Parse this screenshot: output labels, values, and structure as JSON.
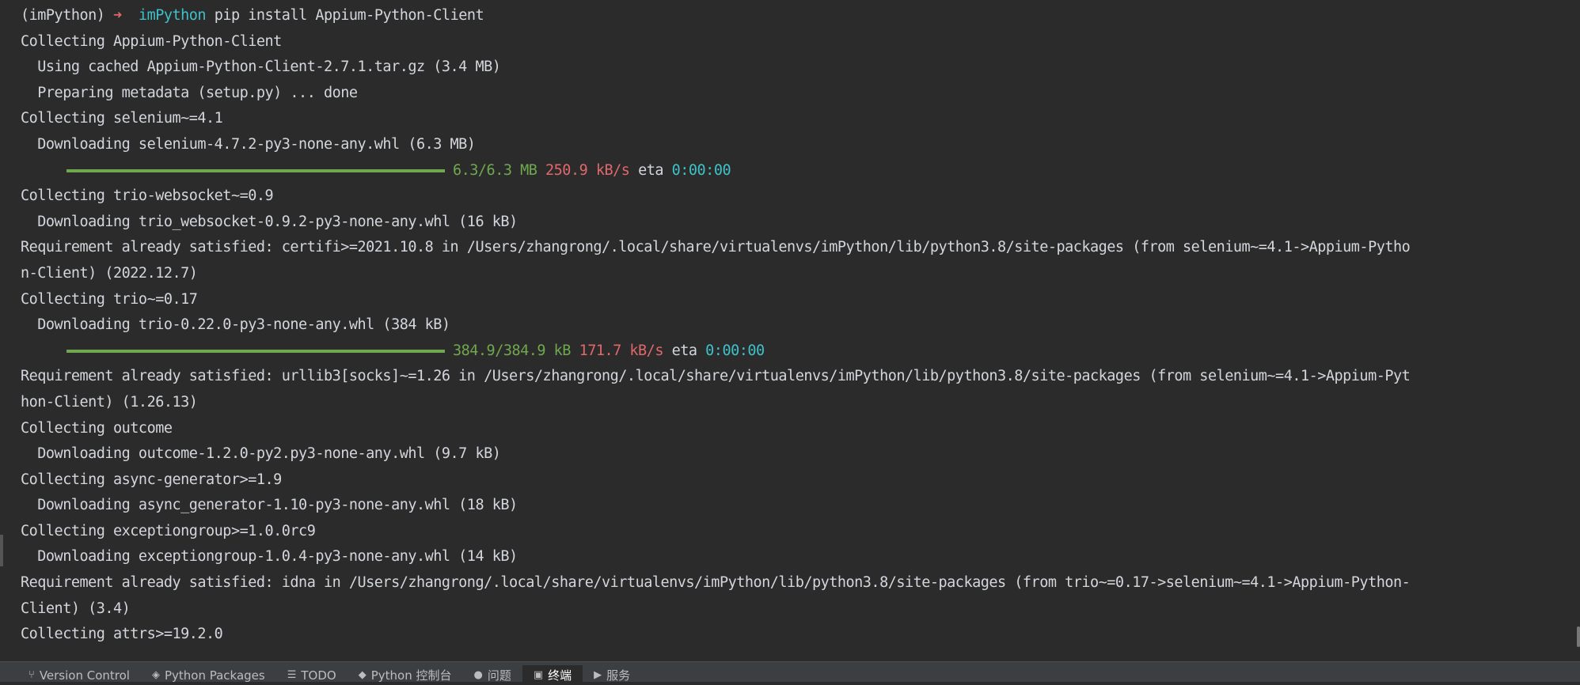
{
  "prompt": {
    "env": "(imPython)",
    "arrow": "➜",
    "dir": "imPython",
    "command": "pip install Appium-Python-Client"
  },
  "lines": [
    "Collecting Appium-Python-Client",
    "  Using cached Appium-Python-Client-2.7.1.tar.gz (3.4 MB)",
    "  Preparing metadata (setup.py) ... done",
    "Collecting selenium~=4.1",
    "  Downloading selenium-4.7.2-py3-none-any.whl (6.3 MB)"
  ],
  "progress1": {
    "fraction": 1.0,
    "size": "6.3/6.3 MB",
    "speed": "250.9 kB/s",
    "eta_label": "eta",
    "eta": "0:00:00"
  },
  "lines2": [
    "Collecting trio-websocket~=0.9",
    "  Downloading trio_websocket-0.9.2-py3-none-any.whl (16 kB)",
    "Requirement already satisfied: certifi>=2021.10.8 in /Users/zhangrong/.local/share/virtualenvs/imPython/lib/python3.8/site-packages (from selenium~=4.1->Appium-Pytho",
    "n-Client) (2022.12.7)",
    "Collecting trio~=0.17",
    "  Downloading trio-0.22.0-py3-none-any.whl (384 kB)"
  ],
  "progress2": {
    "fraction": 1.0,
    "size": "384.9/384.9 kB",
    "speed": "171.7 kB/s",
    "eta_label": "eta",
    "eta": "0:00:00"
  },
  "lines3": [
    "Requirement already satisfied: urllib3[socks]~=1.26 in /Users/zhangrong/.local/share/virtualenvs/imPython/lib/python3.8/site-packages (from selenium~=4.1->Appium-Pyt",
    "hon-Client) (1.26.13)",
    "Collecting outcome",
    "  Downloading outcome-1.2.0-py2.py3-none-any.whl (9.7 kB)",
    "Collecting async-generator>=1.9",
    "  Downloading async_generator-1.10-py3-none-any.whl (18 kB)",
    "Collecting exceptiongroup>=1.0.0rc9",
    "  Downloading exceptiongroup-1.0.4-py3-none-any.whl (14 kB)",
    "Requirement already satisfied: idna in /Users/zhangrong/.local/share/virtualenvs/imPython/lib/python3.8/site-packages (from trio~=0.17->selenium~=4.1->Appium-Python-",
    "Client) (3.4)",
    "Collecting attrs>=19.2.0"
  ],
  "toolbar": {
    "version_control": "Version Control",
    "python_packages": "Python Packages",
    "todo": "TODO",
    "python_console": "Python 控制台",
    "problems": "问题",
    "terminal": "终端",
    "services": "服务"
  },
  "icons": {
    "version_control": "branch-icon",
    "python_packages": "packages-icon",
    "todo": "list-icon",
    "python_console": "python-icon",
    "problems": "warning-icon",
    "terminal": "terminal-icon",
    "services": "play-icon"
  },
  "colors": {
    "background": "#2b2b2b",
    "text": "#d3d6dc",
    "green": "#6fa84f",
    "red": "#e0686b",
    "cyan": "#3ec1c9"
  }
}
